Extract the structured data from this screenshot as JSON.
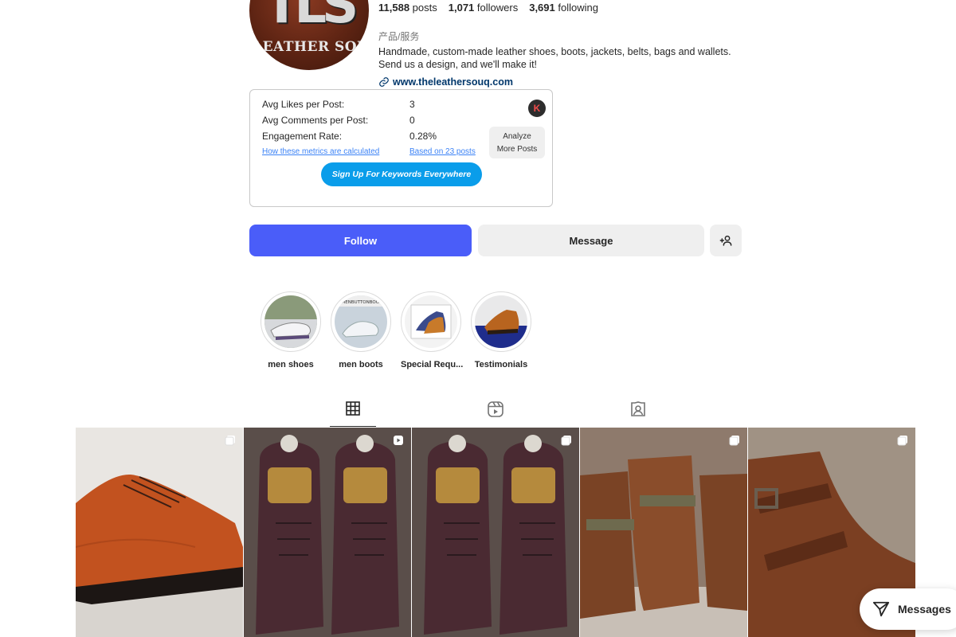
{
  "profile": {
    "avatar_monogram": "TLS",
    "avatar_brand": "E LEATHER SOUQ",
    "stats": {
      "posts_count": "11,588",
      "posts_label": "posts",
      "followers_count": "1,071",
      "followers_label": "followers",
      "following_count": "3,691",
      "following_label": "following"
    },
    "category": "产品/服务",
    "bio_line1": "Handmade, custom-made leather shoes, boots, jackets, belts, bags and wallets.",
    "bio_line2": "Send us a design, and we'll make it!",
    "website": "www.theleathersouq.com"
  },
  "metrics": {
    "avg_likes_label": "Avg Likes per Post:",
    "avg_likes_value": "3",
    "avg_comments_label": "Avg Comments per Post:",
    "avg_comments_value": "0",
    "engagement_label": "Engagement Rate:",
    "engagement_value": "0.28%",
    "how_calculated_link": "How these metrics are calculated",
    "based_on_link": "Based on 23 posts",
    "badge_letter": "K",
    "analyze_line1": "Analyze",
    "analyze_line2": "More Posts",
    "signup_button": "Sign Up For Keywords Everywhere"
  },
  "actions": {
    "follow": "Follow",
    "message": "Message"
  },
  "highlights": [
    {
      "label": "men shoes"
    },
    {
      "label": "men boots",
      "thumb_text": "@MENBUTTONBOOTS"
    },
    {
      "label": "Special Requ..."
    },
    {
      "label": "Testimonials"
    }
  ],
  "tabs": [
    "grid-icon",
    "reels-icon",
    "tagged-icon"
  ],
  "posts": [
    {
      "type": "carousel",
      "color": "#c2521f"
    },
    {
      "type": "reel",
      "color": "#4a2a32"
    },
    {
      "type": "carousel",
      "color": "#4a2a32"
    },
    {
      "type": "carousel",
      "color": "#7a4325"
    },
    {
      "type": "carousel",
      "color": "#7b3f22"
    }
  ],
  "messages_pill": "Messages",
  "colors": {
    "follow_bg": "#4a5df9",
    "signup_bg": "#0a9dea",
    "link": "#00376b"
  }
}
